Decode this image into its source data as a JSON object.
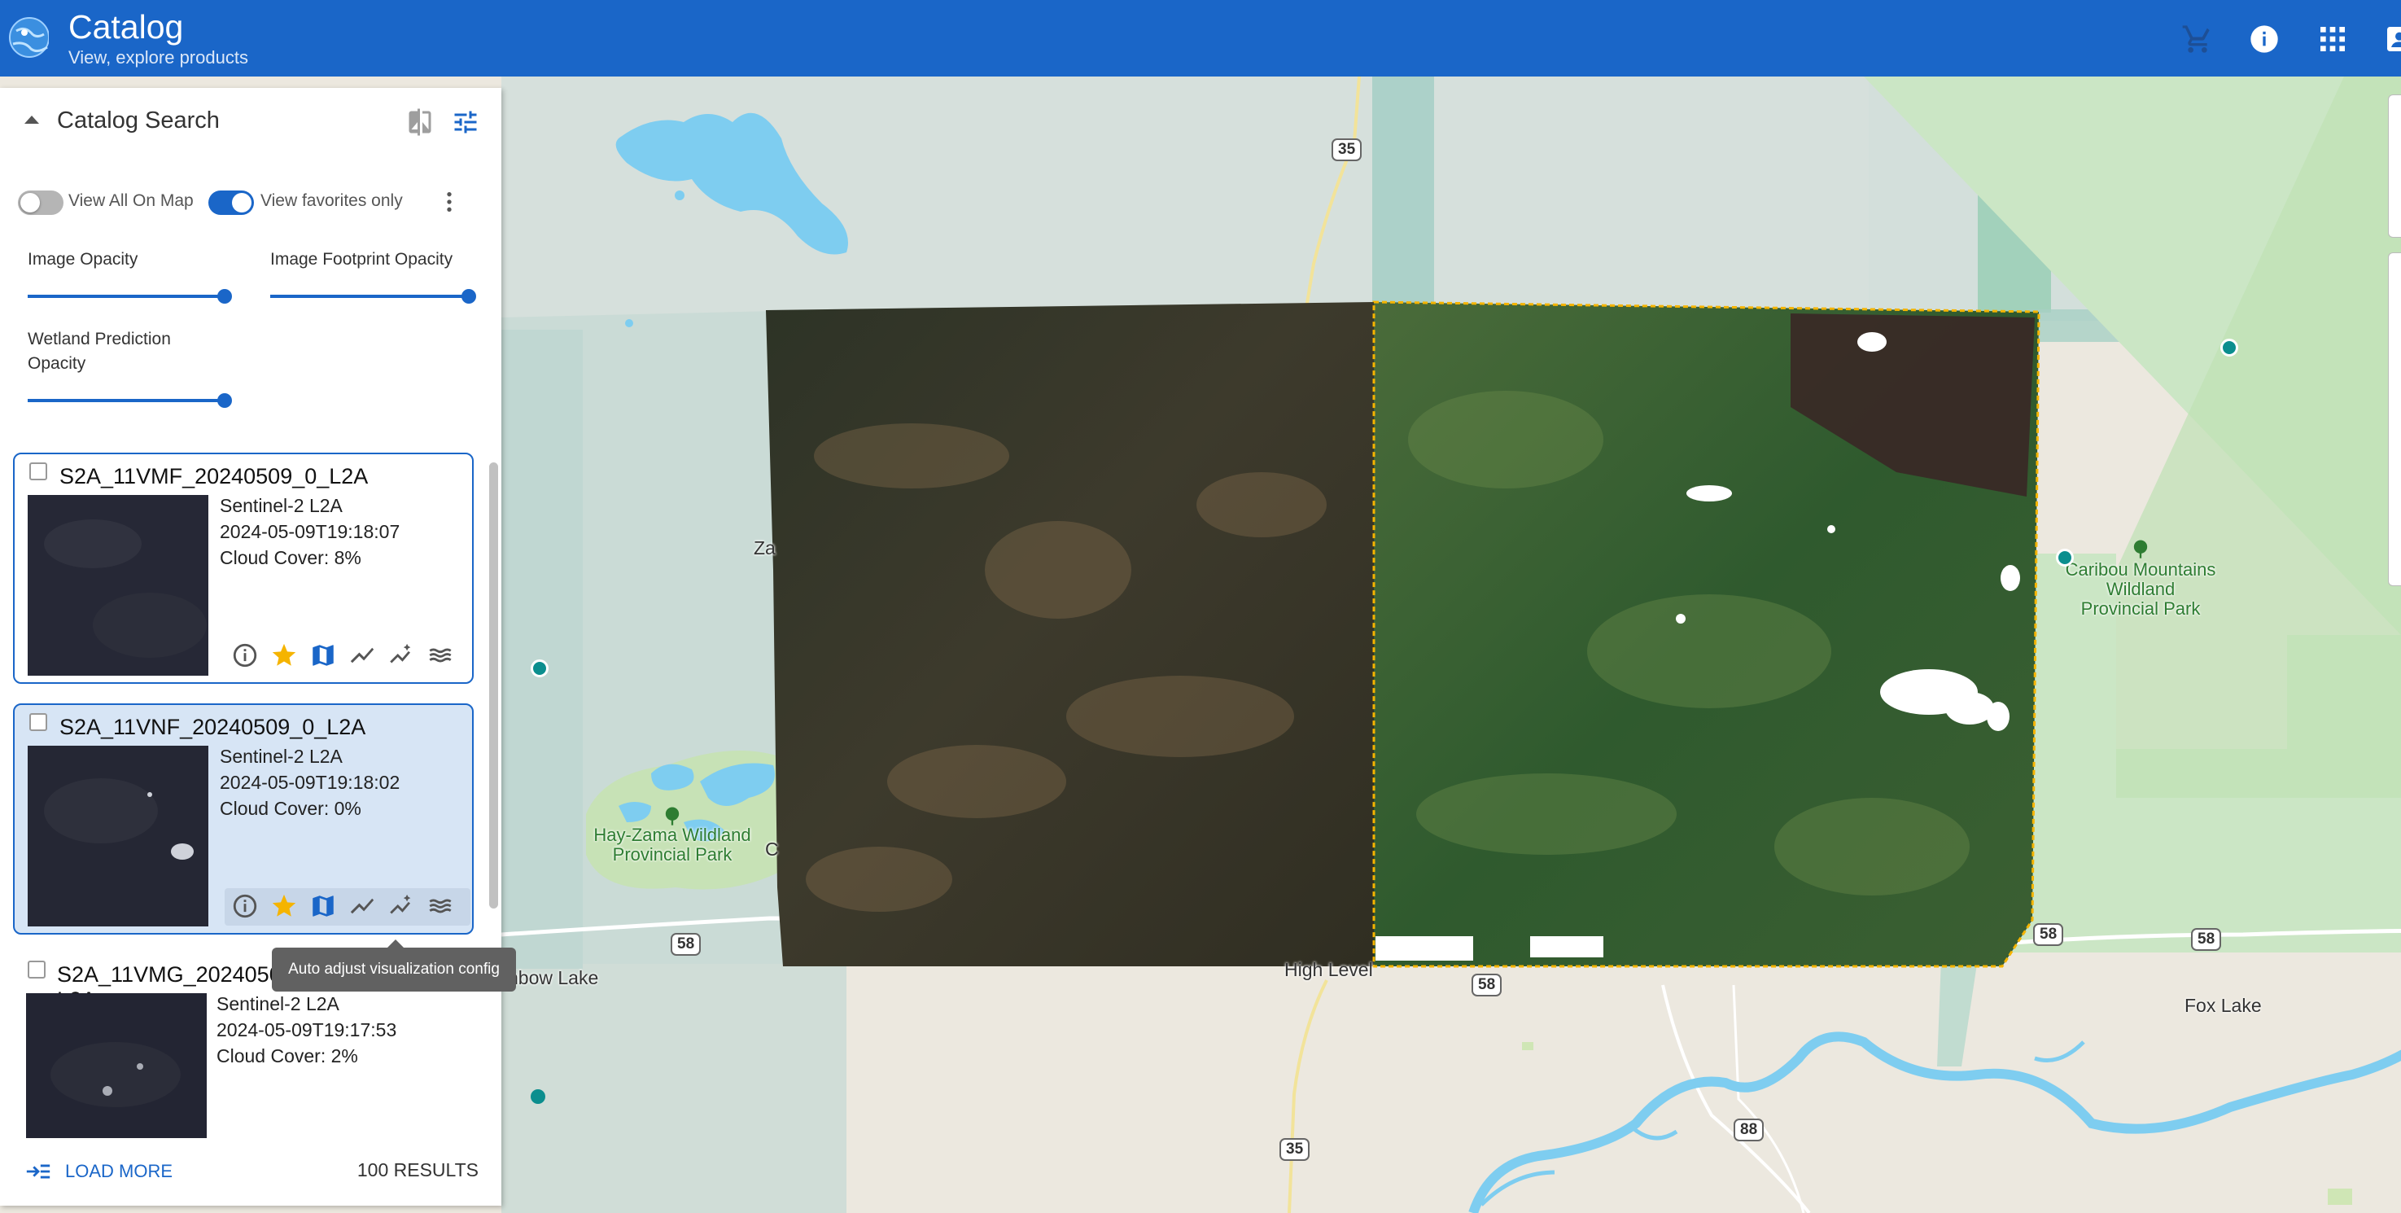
{
  "app": {
    "title": "Catalog",
    "subtitle": "View, explore products",
    "brand_color": "#1a66c8",
    "top_icons": [
      "cart-icon",
      "info-icon",
      "apps-grid-icon",
      "account-icon"
    ]
  },
  "panel": {
    "title": "Catalog Search",
    "header_icons": [
      "compare-icon",
      "filter-settings-icon"
    ],
    "view_all_on_map": {
      "label": "View All On Map",
      "on": false
    },
    "view_favorites_only": {
      "label": "View favorites only",
      "on": true
    },
    "sliders": {
      "image_opacity": {
        "label": "Image Opacity",
        "value": 1.0
      },
      "footprint_opacity": {
        "label": "Image Footprint Opacity",
        "value": 1.0
      },
      "wetland_opacity": {
        "label": "Wetland Prediction Opacity",
        "value": 1.0
      }
    },
    "items": [
      {
        "name": "S2A_11VMF_20240509_0_L2A",
        "type": "Sentinel-2 L2A",
        "datetime": "2024-05-09T19:18:07",
        "cloud": "Cloud Cover: 8%",
        "favorite": true,
        "selected": false
      },
      {
        "name": "S2A_11VNF_20240509_0_L2A",
        "type": "Sentinel-2 L2A",
        "datetime": "2024-05-09T19:18:02",
        "cloud": "Cloud Cover: 0%",
        "favorite": true,
        "selected": true
      },
      {
        "name": "S2A_11VMG_2024050",
        "name_tail": "L2A",
        "type": "Sentinel-2 L2A",
        "datetime": "2024-05-09T19:17:53",
        "cloud": "Cloud Cover: 2%",
        "favorite": false,
        "selected": false
      }
    ],
    "action_icons": [
      "info-icon",
      "star-icon",
      "map-icon",
      "line-chart-icon",
      "auto-adjust-icon",
      "wetland-layers-icon"
    ],
    "tooltip": "Auto adjust visualization config",
    "load_more": "LOAD MORE",
    "results": "100 RESULTS"
  },
  "map": {
    "places": {
      "high_level": "High Level",
      "fox_lake": "Fox Lake",
      "rainbow_lake": "nbow Lake",
      "za": "Za",
      "c": "C"
    },
    "parks": {
      "hay_zama_1": "Hay-Zama Wildland",
      "hay_zama_2": "Provincial Park",
      "caribou_1": "Caribou Mountains",
      "caribou_2": "Wildland",
      "caribou_3": "Provincial Park"
    },
    "shields": {
      "hwy35": "35",
      "hwy58": "58",
      "hwy88": "88",
      "hwy35b": "35"
    }
  }
}
